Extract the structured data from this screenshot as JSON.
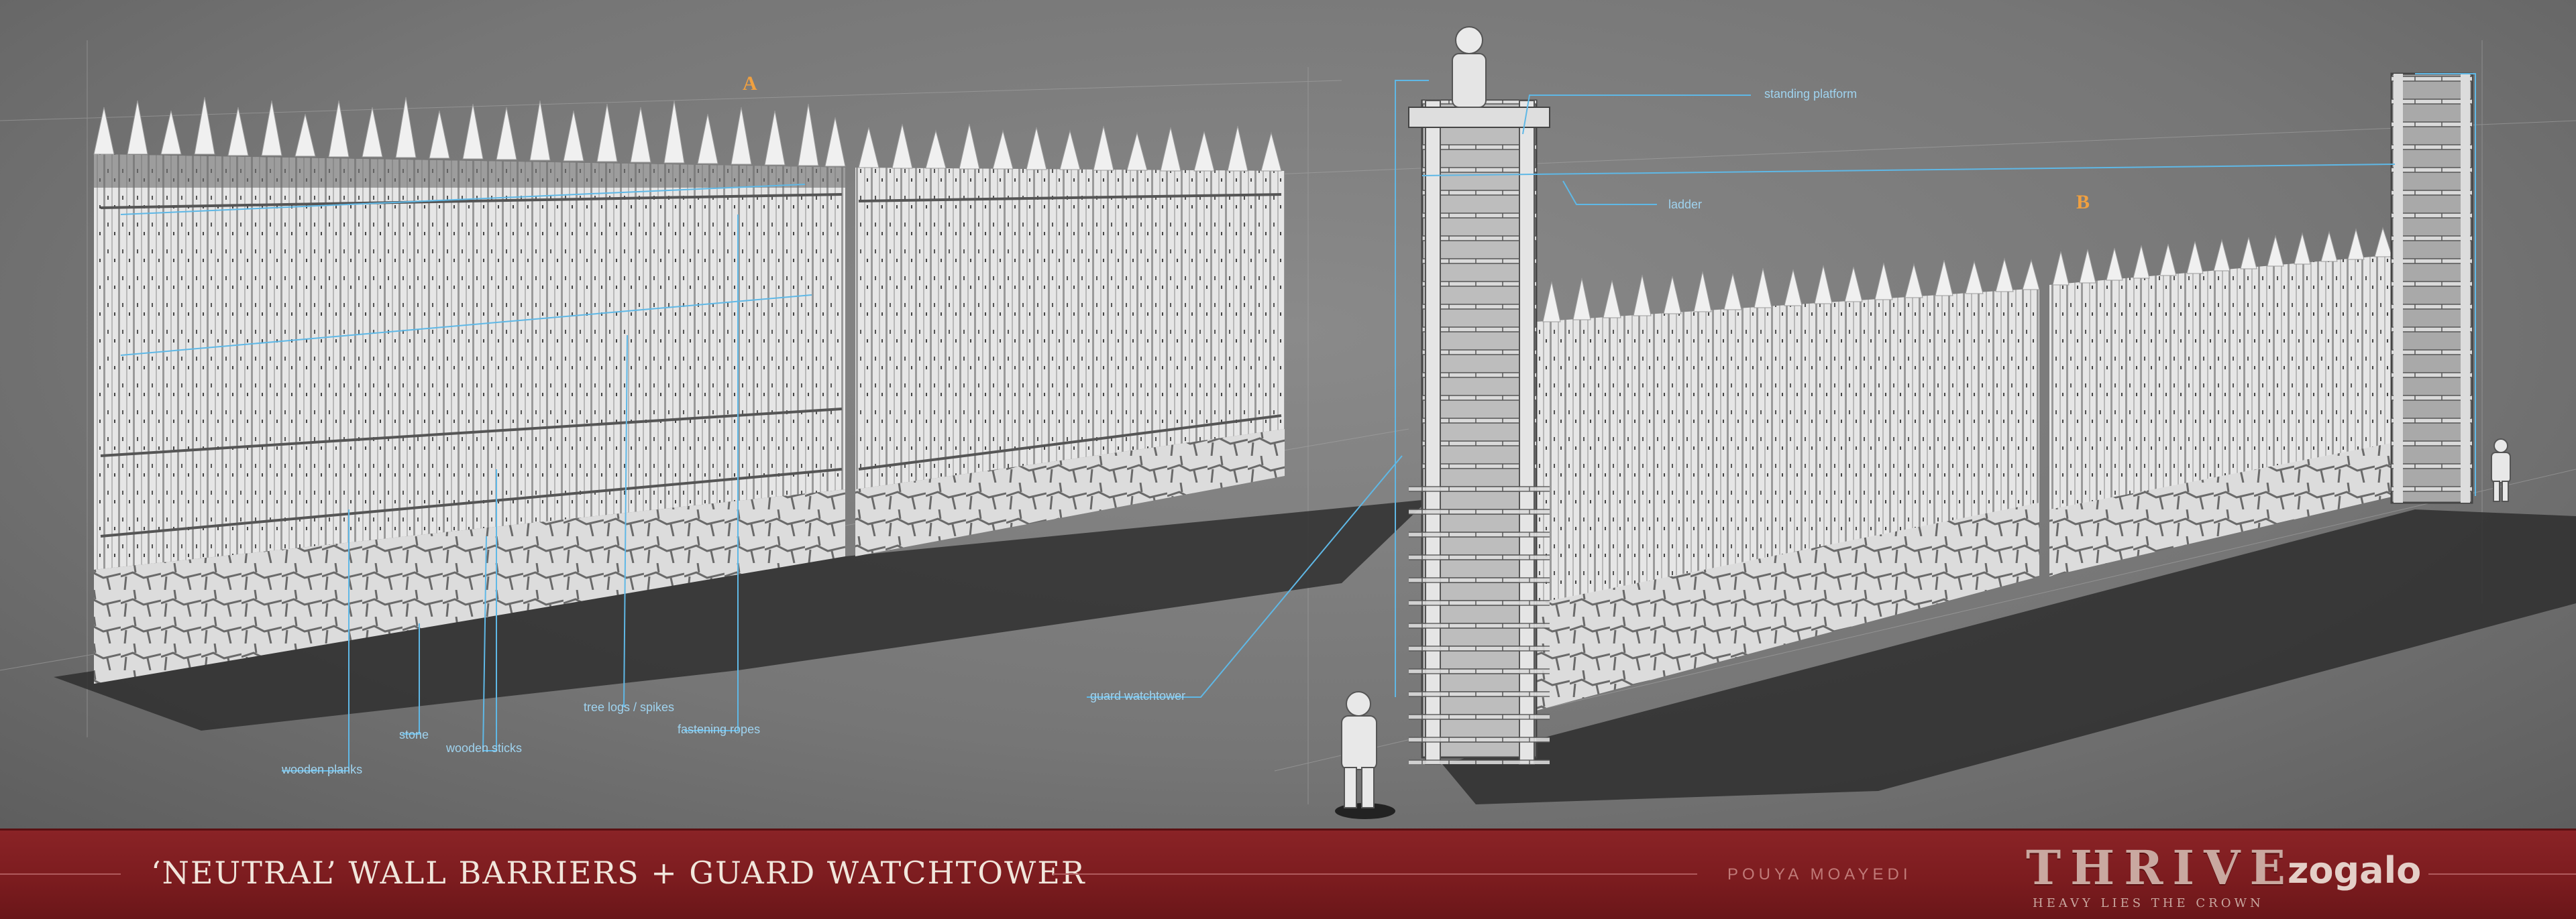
{
  "section_labels": {
    "a": "A",
    "b": "B"
  },
  "callouts": {
    "wooden_planks": "wooden planks",
    "stone": "stone",
    "wooden_sticks": "wooden sticks",
    "tree_logs": "tree logs / spikes",
    "fastening_ropes": "fastening ropes",
    "guard_watchtower": "guard watchtower",
    "standing_platform": "standing platform",
    "ladder": "ladder"
  },
  "footer": {
    "title": "‘NEUTRAL’ WALL BARRIERS + GUARD WATCHTOWER",
    "author": "POUYA MOAYEDI",
    "brand": "THRIVE",
    "brand_subtitle": "HEAVY LIES THE CROWN",
    "studio": "zogalo"
  },
  "colors": {
    "callout_line": "#5fb8e6",
    "callout_text": "#9fd3ef",
    "section_letter": "#f0a040",
    "footer_bg": "#7c1c1f",
    "wall": "#e9e9e9",
    "shadow": "#2e2e2e"
  }
}
